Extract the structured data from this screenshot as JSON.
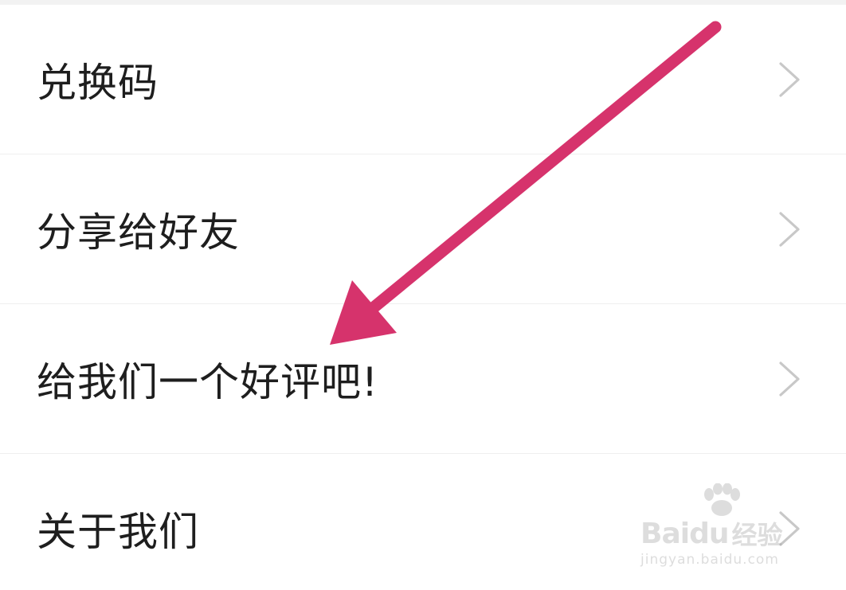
{
  "menu": {
    "items": [
      {
        "label": "兑换码",
        "chevron": "chevron-right-icon"
      },
      {
        "label": "分享给好友",
        "chevron": "chevron-right-icon"
      },
      {
        "label": "给我们一个好评吧!",
        "chevron": "chevron-right-icon"
      },
      {
        "label": "关于我们",
        "chevron": "chevron-right-icon"
      }
    ]
  },
  "annotation": {
    "arrow_color": "#d6336c",
    "points_to": "给我们一个好评吧!"
  },
  "watermark": {
    "brand": "Baidu",
    "product": "经验",
    "url": "jingyan.baidu.com",
    "icon": "paw-icon"
  },
  "colors": {
    "text": "#1e1e1e",
    "divider": "#efefef",
    "chevron": "#c8c8c8",
    "background": "#ffffff"
  }
}
